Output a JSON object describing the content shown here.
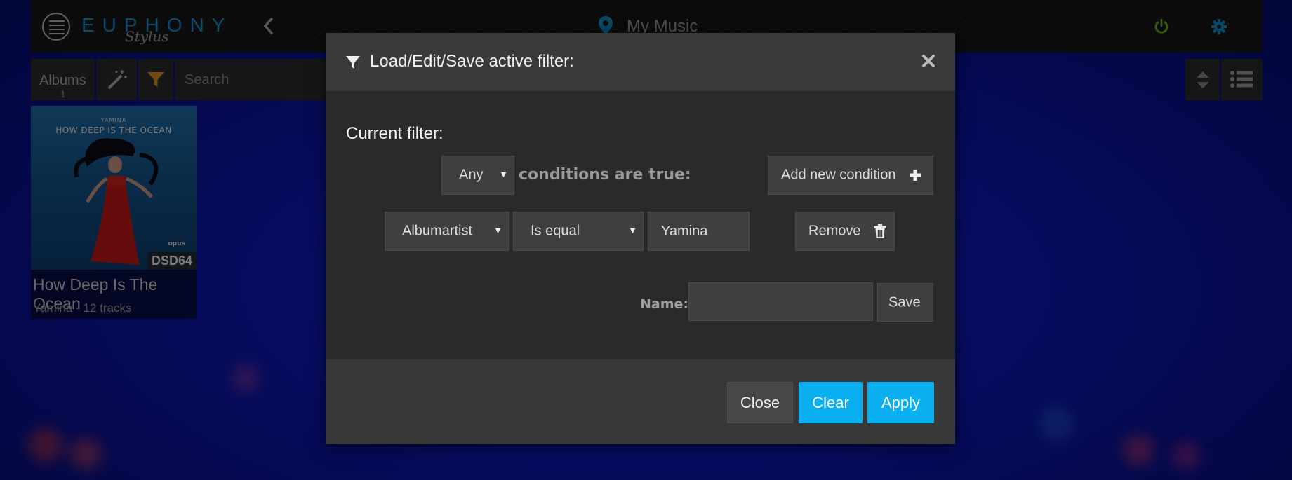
{
  "header": {
    "logo_text": "EUPHONY",
    "logo_sub": "Stylus",
    "location": "My Music"
  },
  "toolbar": {
    "albums_label": "Albums",
    "albums_count": "1",
    "search_placeholder": "Search"
  },
  "album": {
    "cover_artist": "YAMINA",
    "cover_title": "HOW DEEP IS THE OCEAN",
    "cover_label": "opus",
    "format_badge": "DSD64",
    "title": "How Deep Is The Ocean",
    "subtitle": "Yamina - 12 tracks"
  },
  "modal": {
    "title": "Load/Edit/Save active filter:",
    "section_title": "Current filter:",
    "match_select": "Any",
    "conditions_text": "conditions are true:",
    "add_condition_label": "Add new condition",
    "condition": {
      "field": "Albumartist",
      "operator": "Is equal",
      "value": "Yamina"
    },
    "remove_label": "Remove",
    "name_label": "Name:",
    "name_value": "",
    "save_label": "Save",
    "close_label": "Close",
    "clear_label": "Clear",
    "apply_label": "Apply"
  },
  "colors": {
    "accent": "#0aaff0",
    "filter_orange": "#e08a1e",
    "power_green": "#6bb31f",
    "logo_blue": "#0e8fc9"
  }
}
